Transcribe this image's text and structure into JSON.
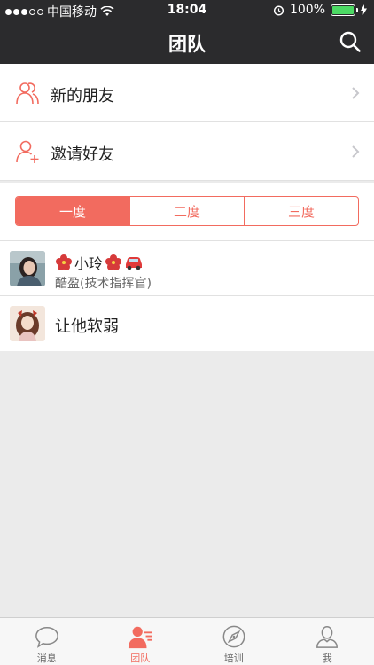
{
  "status_bar": {
    "carrier": "中国移动",
    "time": "18:04",
    "battery": "100%"
  },
  "nav": {
    "title": "团队"
  },
  "menu": [
    {
      "label": "新的朋友",
      "icon": "people-icon"
    },
    {
      "label": "邀请好友",
      "icon": "add-person-icon"
    }
  ],
  "segments": {
    "items": [
      "一度",
      "二度",
      "三度"
    ],
    "active": 0
  },
  "members": [
    {
      "name": "小玲",
      "subtitle": "酷盈(技术指挥官)"
    },
    {
      "name": "让他软弱",
      "subtitle": ""
    }
  ],
  "tabbar": {
    "items": [
      {
        "label": "消息",
        "icon": "chat-bubble-icon"
      },
      {
        "label": "团队",
        "icon": "team-icon"
      },
      {
        "label": "培训",
        "icon": "compass-icon"
      },
      {
        "label": "我",
        "icon": "person-icon"
      }
    ],
    "active": 1
  },
  "colors": {
    "accent": "#f26b5f",
    "navbar": "#2b2b2d",
    "background": "#ebebeb"
  }
}
